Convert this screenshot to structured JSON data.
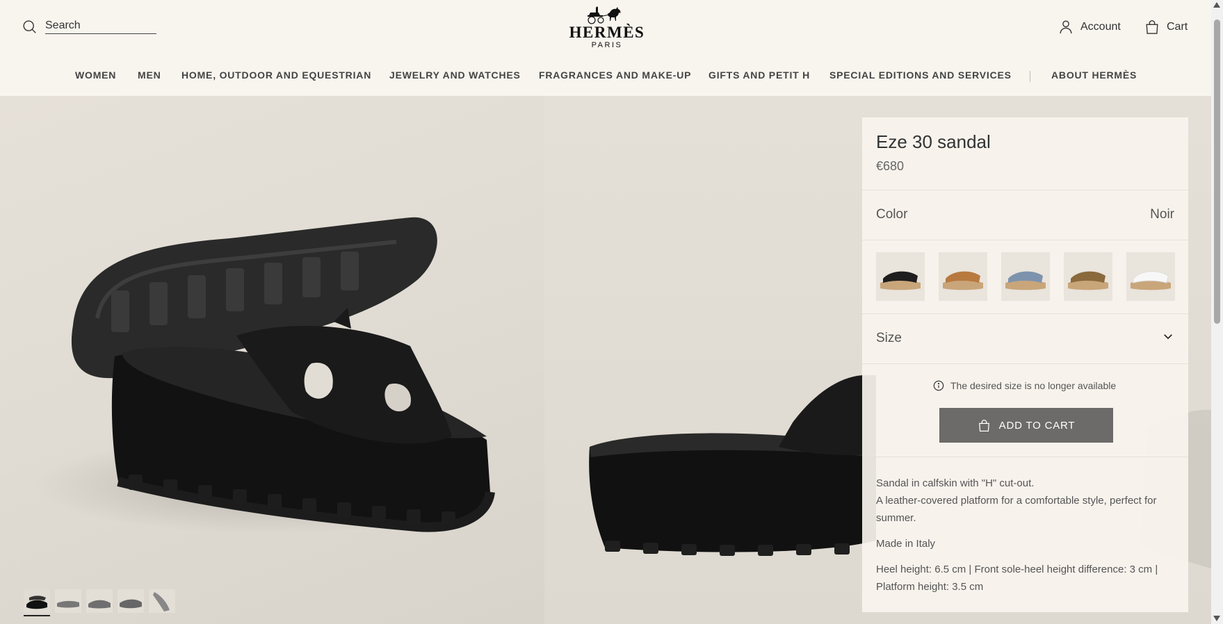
{
  "header": {
    "search_placeholder": "Search",
    "logo_brand": "HERMÈS",
    "logo_city": "PARIS",
    "account_label": "Account",
    "cart_label": "Cart"
  },
  "nav": {
    "items": [
      {
        "label": "WOMEN"
      },
      {
        "label": "MEN"
      },
      {
        "label": "HOME, OUTDOOR AND EQUESTRIAN"
      },
      {
        "label": "JEWELRY AND WATCHES"
      },
      {
        "label": "FRAGRANCES AND MAKE-UP"
      },
      {
        "label": "GIFTS AND PETIT H"
      },
      {
        "label": "SPECIAL EDITIONS AND SERVICES"
      },
      {
        "label": "ABOUT HERMÈS"
      }
    ]
  },
  "product": {
    "title": "Eze 30 sandal",
    "price": "€680",
    "color_label": "Color",
    "color_value": "Noir",
    "swatches": [
      {
        "color": "#1e1e1e",
        "sole": "#c9a57a"
      },
      {
        "color": "#b8793f",
        "sole": "#c9a57a"
      },
      {
        "color": "#7d93ad",
        "sole": "#c9a57a"
      },
      {
        "color": "#8a6a3c",
        "sole": "#c9a57a"
      },
      {
        "color": "#f2f2f2",
        "sole": "#c9a57a"
      }
    ],
    "size_label": "Size",
    "notice": "The desired size is no longer available",
    "add_to_cart": "ADD TO CART",
    "description": [
      "Sandal in calfskin with \"H\" cut-out.",
      "A leather-covered platform for a comfortable style, perfect for summer.",
      "Made in Italy",
      "Heel height: 6.5 cm | Front sole-heel height difference: 3 cm | Platform height: 3.5 cm"
    ]
  },
  "colors": {
    "header_bg": "#f8f4ee",
    "button_bg": "#6d6b69",
    "text": "#444444"
  }
}
